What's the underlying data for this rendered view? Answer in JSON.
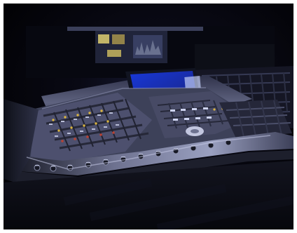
{
  "photo": {
    "subject": "mixing-console-photo"
  },
  "colors": {
    "background": "#04040a",
    "console_body": "#4a4c63",
    "screen_blue": "#2424a8",
    "screen_highlight": "#9fb6ff",
    "panel_light": "#7b7f9a",
    "led_amber": "#d8b341",
    "led_red": "#b74234"
  }
}
